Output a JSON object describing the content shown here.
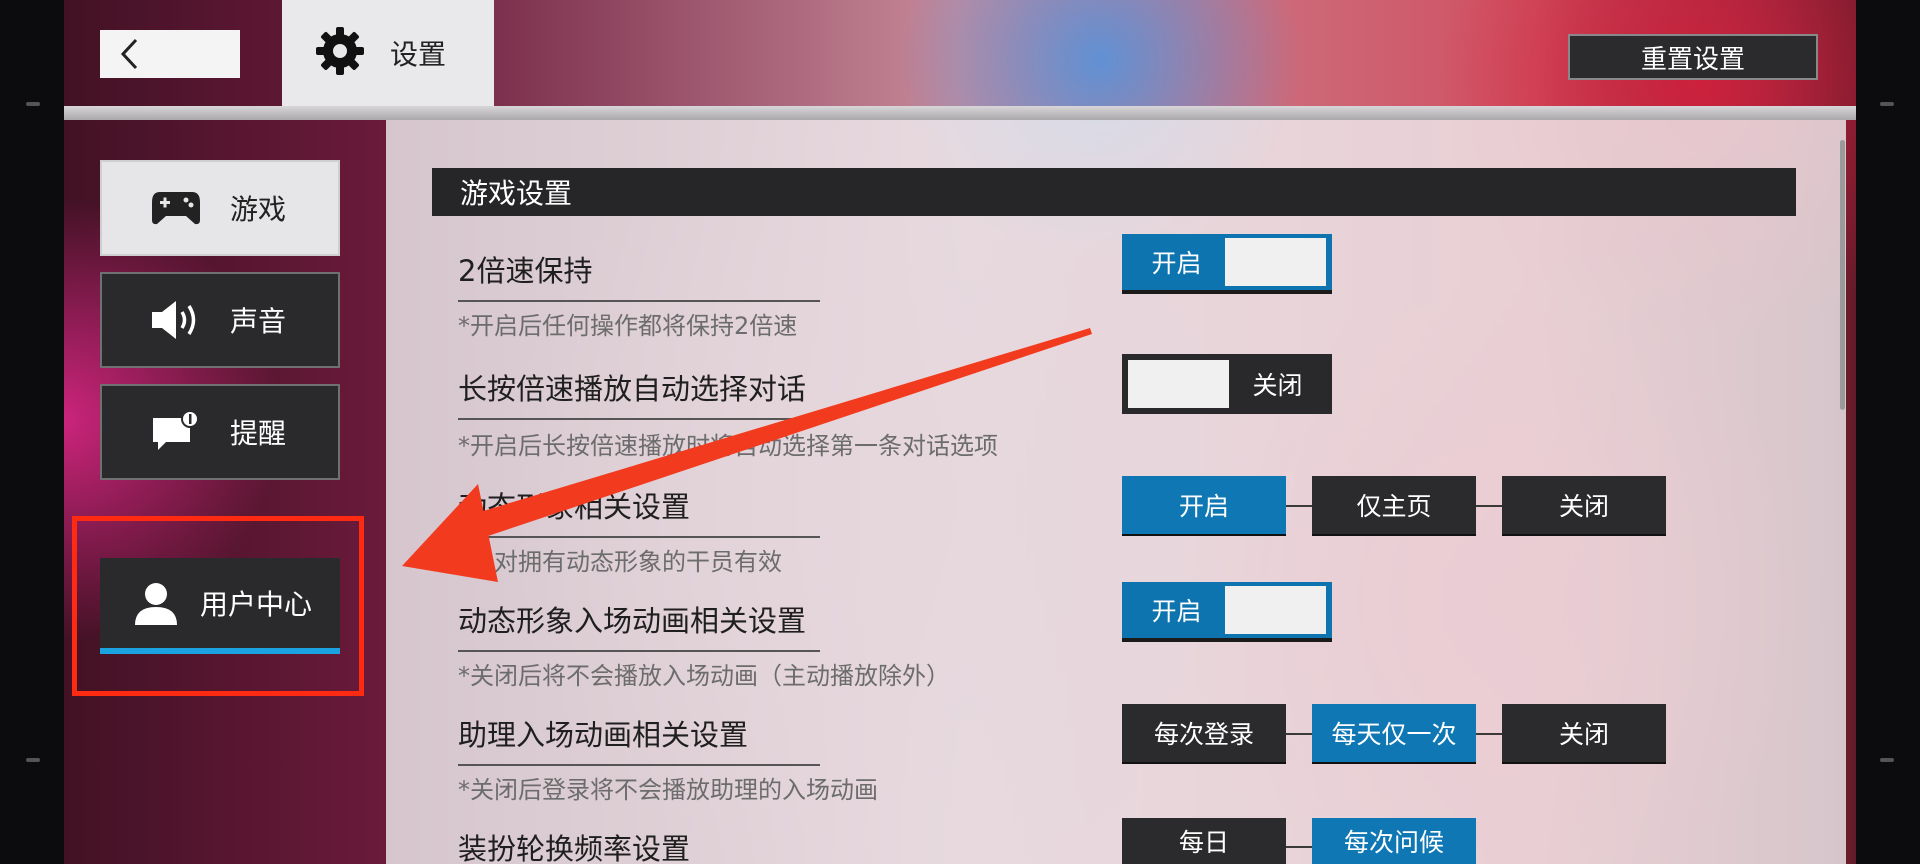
{
  "header": {
    "title": "设置",
    "reset_label": "重置设置"
  },
  "sidebar": {
    "items": [
      {
        "label": "游戏",
        "icon": "gamepad-icon"
      },
      {
        "label": "声音",
        "icon": "speaker-icon"
      },
      {
        "label": "提醒",
        "icon": "notification-icon"
      },
      {
        "label": "用户中心",
        "icon": "user-icon"
      }
    ]
  },
  "section": {
    "title": "游戏设置"
  },
  "settings": [
    {
      "title": "2倍速保持",
      "note": "*开启后任何操作都将保持2倍速",
      "toggle_label": "开启",
      "state": "on"
    },
    {
      "title": "长按倍速播放自动选择对话",
      "note": "*开启后长按倍速播放时将自动选择第一条对话选项",
      "toggle_label": "关闭",
      "state": "off"
    },
    {
      "title": "动态形象相关设置",
      "note": "*仅对拥有动态形象的干员有效",
      "options": [
        "开启",
        "仅主页",
        "关闭"
      ],
      "selected": "开启"
    },
    {
      "title": "动态形象入场动画相关设置",
      "note": "*关闭后将不会播放入场动画（主动播放除外）",
      "toggle_label": "开启",
      "state": "on"
    },
    {
      "title": "助理入场动画相关设置",
      "note": "*关闭后登录将不会播放助理的入场动画",
      "options": [
        "每次登录",
        "每天仅一次",
        "关闭"
      ],
      "selected": "每天仅一次"
    },
    {
      "title": "装扮轮换频率设置",
      "options": [
        "每日",
        "每次问候"
      ],
      "selected": "每次问候"
    }
  ],
  "colors": {
    "accent_blue": "#0f78b4",
    "highlight_red": "#ff2a12",
    "arrow_red": "#f23a1e"
  }
}
